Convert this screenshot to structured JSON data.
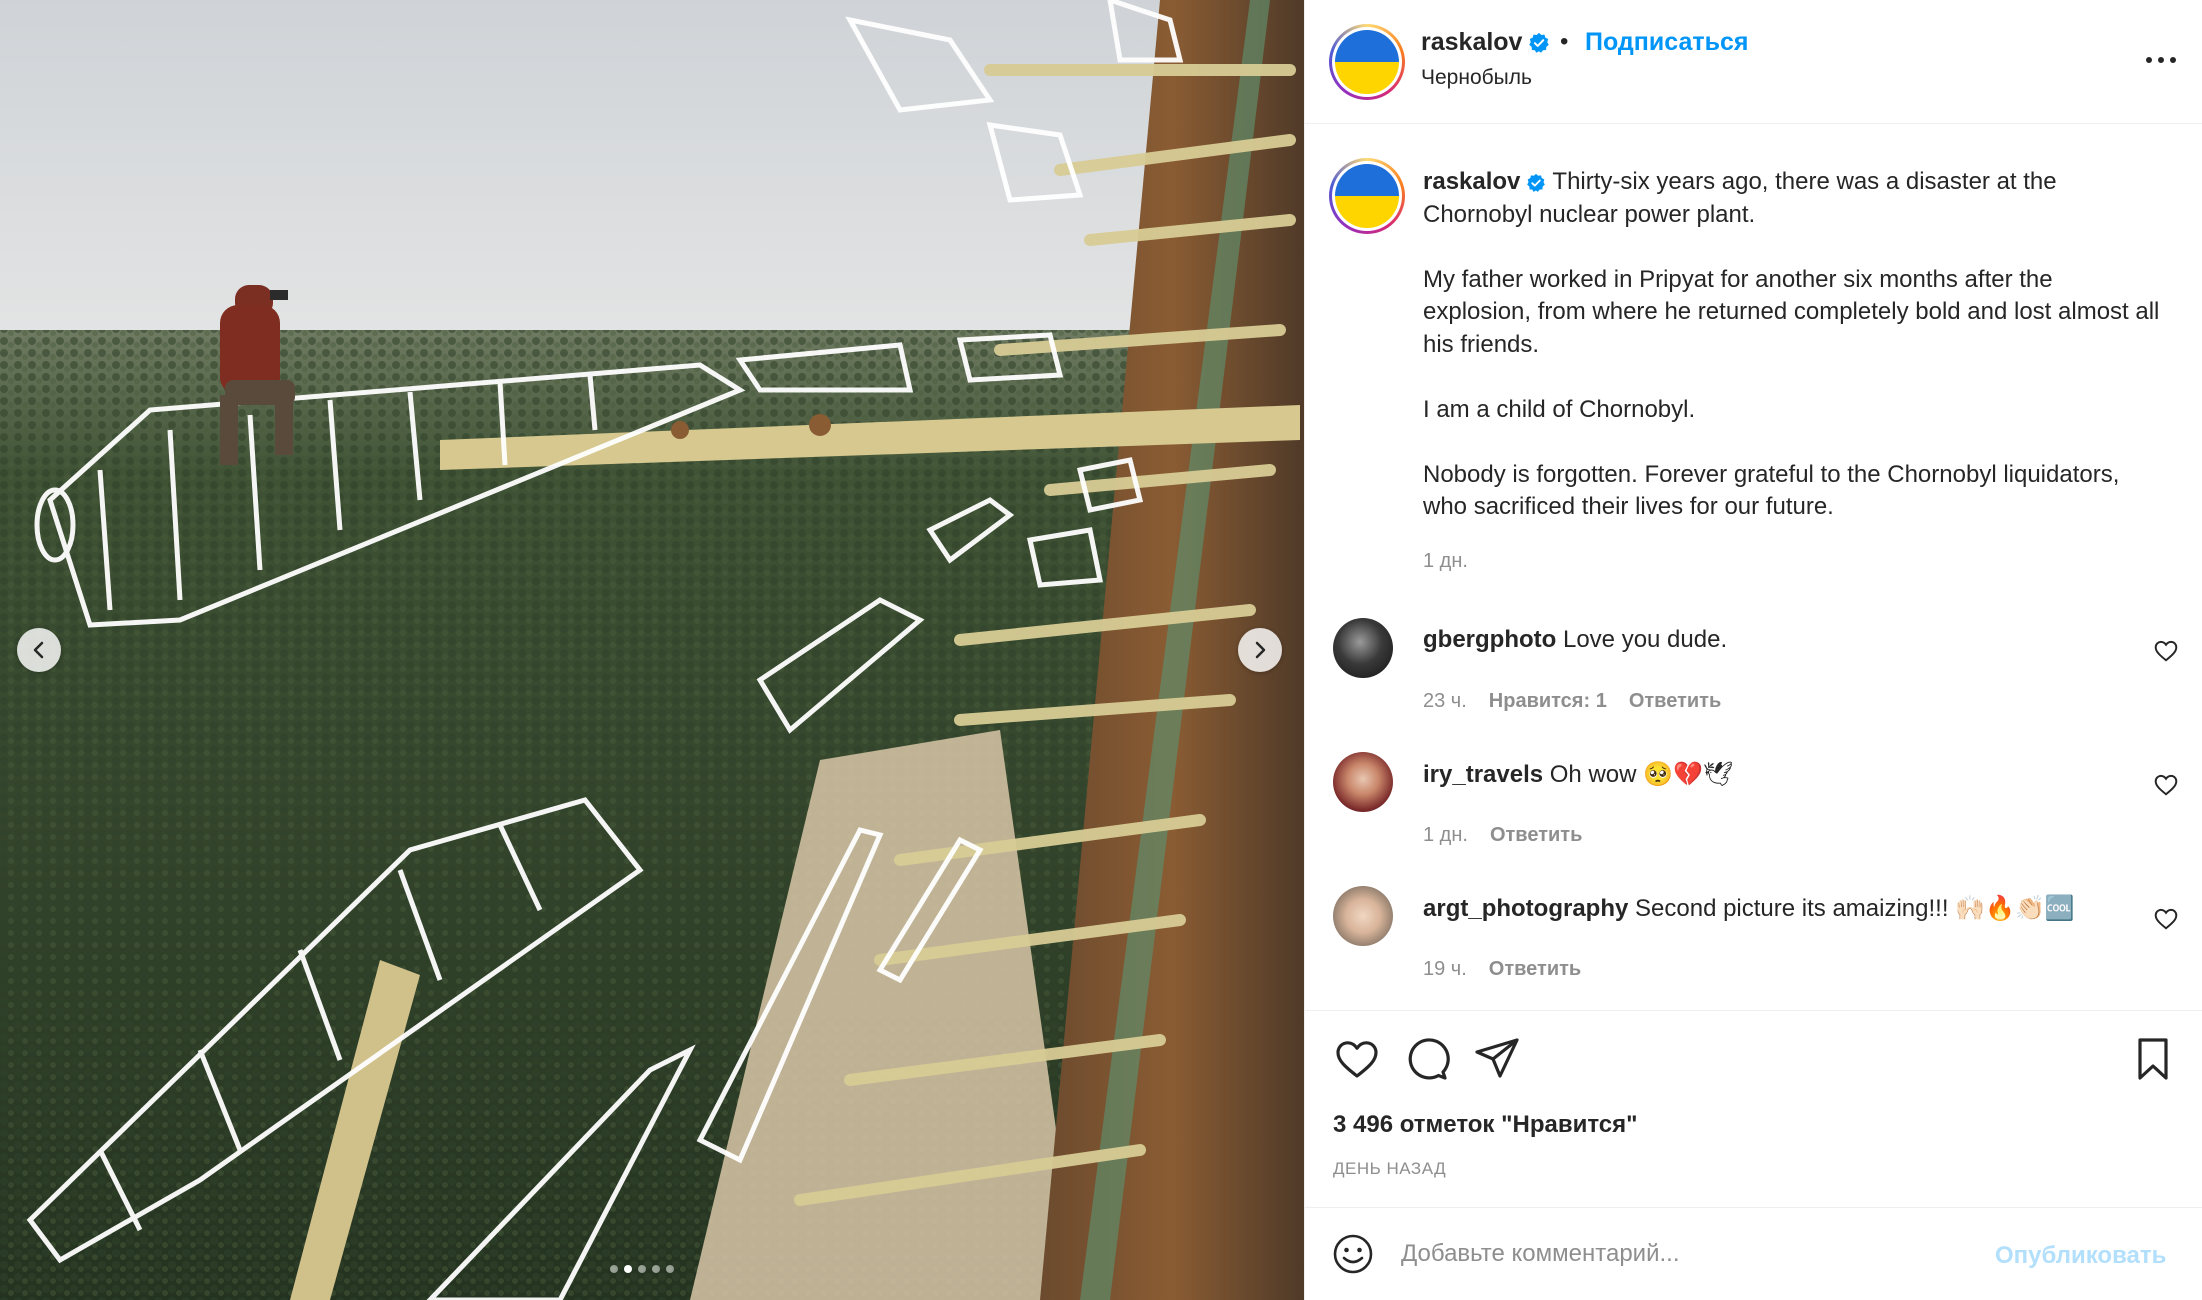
{
  "post": {
    "username": "raskalov",
    "follow_label": "Подписаться",
    "separator": "•",
    "location": "Чернобыль",
    "more_label": "..."
  },
  "caption": {
    "username": "raskalov",
    "paragraphs": [
      "Thirty-six years ago, there was a disaster at the Chornobyl nuclear power plant.",
      "My father worked in Pripyat for another six months after the explosion, from where he returned completely bold and lost almost all his friends.",
      "I am a child of Chornobyl.",
      "Nobody is forgotten. Forever grateful to the Chornobyl liquidators, who sacrificed their lives for our future."
    ],
    "time": "1 дн."
  },
  "comments": [
    {
      "username": "gbergphoto",
      "text": "Love you dude.",
      "time": "23 ч.",
      "likes": "Нравится: 1",
      "reply": "Ответить"
    },
    {
      "username": "iry_travels",
      "text": "Oh wow 🥺💔🕊",
      "time": "1 дн.",
      "reply": "Ответить"
    },
    {
      "username": "argt_photography",
      "text": "Second picture its amaizing!!! 🙌🏻🔥👏🏻🆒",
      "time": "19 ч.",
      "reply": "Ответить"
    }
  ],
  "stats": {
    "likes": "3 496 отметок \"Нравится\"",
    "date": "ДЕНЬ НАЗАД"
  },
  "composer": {
    "placeholder": "Добавьте комментарий...",
    "publish_label": "Опубликовать"
  },
  "carousel": {
    "slide_count": 5,
    "active_index": 1
  },
  "colors": {
    "accent": "#0095f6",
    "publish_disabled": "#b2dffc",
    "verified": "#0095f6",
    "flag_blue": "#1e6fd9",
    "flag_yellow": "#ffd500"
  },
  "icons": {
    "like": "heart-icon",
    "comment": "comment-icon",
    "share": "share-icon",
    "save": "bookmark-icon",
    "emoji": "emoji-icon",
    "more": "more-icon"
  }
}
